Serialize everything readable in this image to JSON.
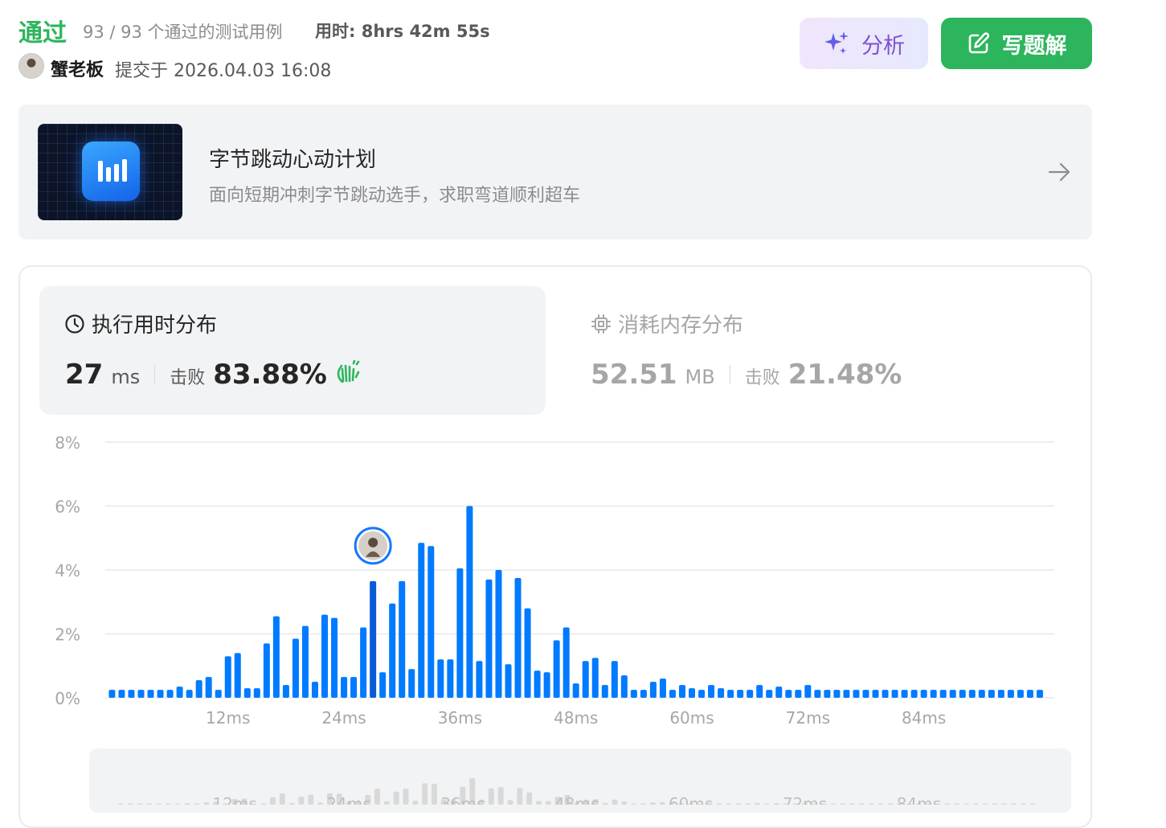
{
  "header": {
    "status": "通过",
    "cases_text": "93 / 93 个通过的测试用例",
    "runtime_text": "用时: 8hrs 42m 55s",
    "username": "蟹老板",
    "submitted_text": "提交于 2026.04.03 16:08"
  },
  "actions": {
    "analyze_label": "分析",
    "solution_label": "写题解"
  },
  "promo": {
    "title": "字节跳动心动计划",
    "subtitle": "面向短期冲刺字节跳动选手，求职弯道顺利超车"
  },
  "stats": {
    "time": {
      "title": "执行用时分布",
      "value": "27",
      "unit": "ms",
      "beat_label": "击败",
      "beat_value": "83.88%"
    },
    "memory": {
      "title": "消耗内存分布",
      "value": "52.51",
      "unit": "MB",
      "beat_label": "击败",
      "beat_value": "21.48%"
    }
  },
  "colors": {
    "accent": "#2db55d",
    "bar": "#007aff",
    "bar_mine": "#0a5bd6",
    "muted": "#a6a6a6"
  },
  "chart_data": {
    "type": "bar",
    "yticks": [
      "0%",
      "2%",
      "4%",
      "6%",
      "8%"
    ],
    "ylim": [
      0,
      8
    ],
    "xticks": [
      {
        "label": "12ms",
        "x": 12
      },
      {
        "label": "24ms",
        "x": 24
      },
      {
        "label": "36ms",
        "x": 36
      },
      {
        "label": "48ms",
        "x": 48
      },
      {
        "label": "60ms",
        "x": 60
      },
      {
        "label": "72ms",
        "x": 72
      },
      {
        "label": "84ms",
        "x": 84
      }
    ],
    "xlim": [
      -0.7,
      97.5
    ],
    "grid": true,
    "highlight_x": 27,
    "x": [
      0,
      1,
      2,
      3,
      4,
      5,
      6,
      7,
      8,
      9,
      10,
      11,
      12,
      13,
      14,
      15,
      16,
      17,
      18,
      19,
      20,
      21,
      22,
      23,
      24,
      25,
      26,
      27,
      28,
      29,
      30,
      31,
      32,
      33,
      34,
      35,
      36,
      37,
      38,
      39,
      40,
      41,
      42,
      43,
      44,
      45,
      46,
      47,
      48,
      49,
      50,
      51,
      52,
      53,
      54,
      55,
      56,
      57,
      58,
      59,
      60,
      61,
      62,
      63,
      64,
      65,
      66,
      67,
      68,
      69,
      70,
      71,
      72,
      73,
      74,
      75,
      76,
      77,
      78,
      79,
      80,
      81,
      82,
      83,
      84,
      85,
      86,
      87,
      88,
      89,
      90,
      91,
      92,
      93,
      94,
      95,
      96
    ],
    "values": [
      0.25,
      0.25,
      0.25,
      0.25,
      0.25,
      0.25,
      0.25,
      0.35,
      0.25,
      0.55,
      0.65,
      0.25,
      1.3,
      1.4,
      0.3,
      0.3,
      1.7,
      2.55,
      0.4,
      1.85,
      2.25,
      0.5,
      2.6,
      2.5,
      0.65,
      0.65,
      2.2,
      3.65,
      0.8,
      2.95,
      3.65,
      0.9,
      4.85,
      4.75,
      1.2,
      1.2,
      4.05,
      6.0,
      1.15,
      3.7,
      4.0,
      1.05,
      3.75,
      2.8,
      0.85,
      0.8,
      1.8,
      2.2,
      0.45,
      1.15,
      1.25,
      0.4,
      1.15,
      0.7,
      0.25,
      0.25,
      0.5,
      0.6,
      0.25,
      0.4,
      0.3,
      0.25,
      0.4,
      0.3,
      0.25,
      0.25,
      0.25,
      0.4,
      0.25,
      0.35,
      0.25,
      0.25,
      0.4,
      0.25,
      0.25,
      0.25,
      0.25,
      0.25,
      0.25,
      0.25,
      0.25,
      0.25,
      0.25,
      0.25,
      0.25,
      0.25,
      0.25,
      0.25,
      0.25,
      0.25,
      0.25,
      0.25,
      0.25,
      0.25,
      0.25,
      0.25,
      0.25
    ]
  }
}
